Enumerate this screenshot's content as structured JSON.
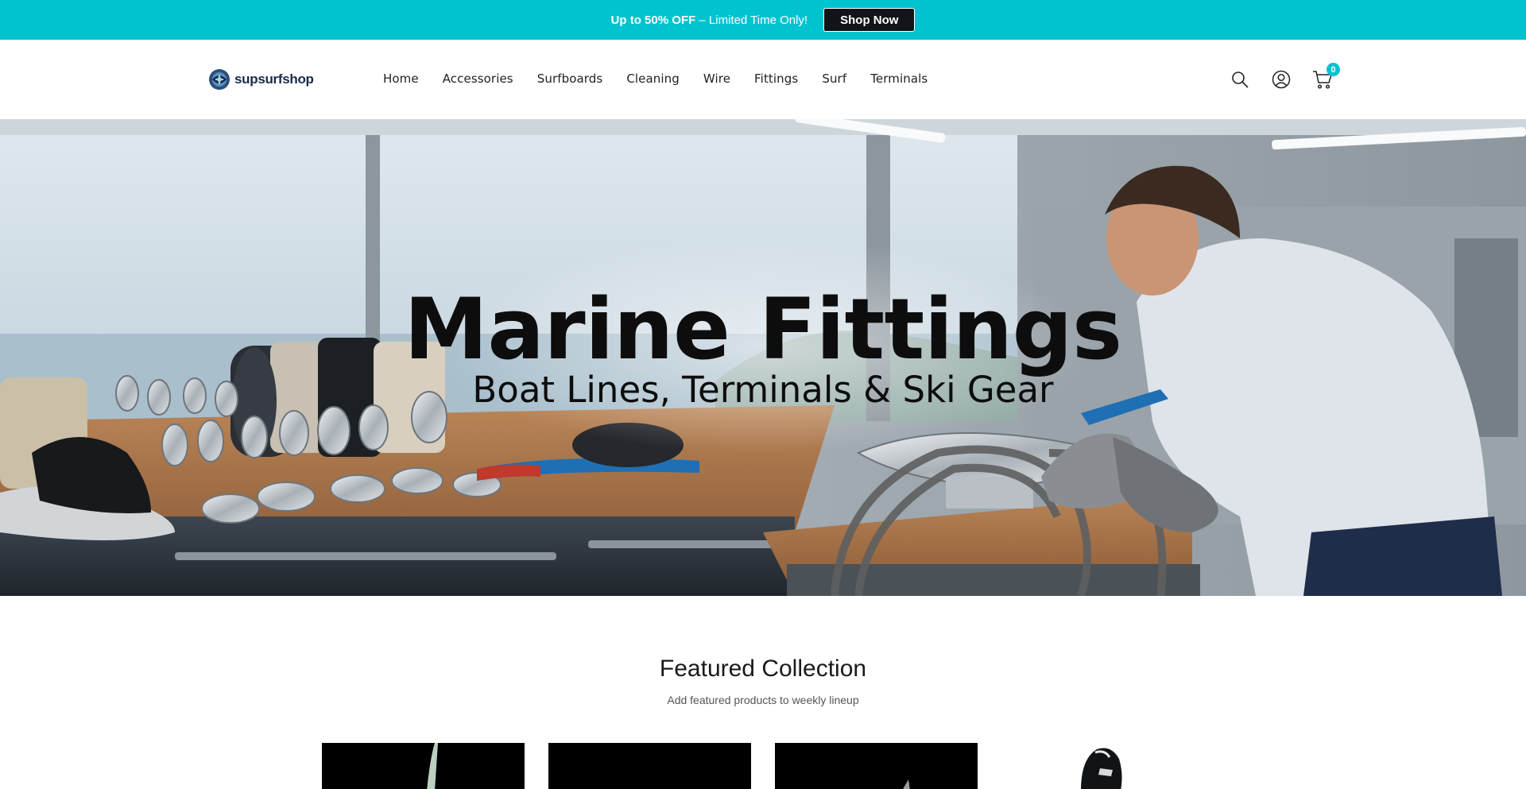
{
  "announcement": {
    "highlight": "Up to 50% OFF",
    "text": " – Limited Time Only!",
    "cta_label": "Shop Now"
  },
  "header": {
    "logo_text": "supsurfshop",
    "nav": [
      {
        "label": "Home"
      },
      {
        "label": "Accessories"
      },
      {
        "label": "Surfboards"
      },
      {
        "label": "Cleaning"
      },
      {
        "label": "Wire"
      },
      {
        "label": "Fittings"
      },
      {
        "label": "Surf"
      },
      {
        "label": "Terminals"
      }
    ],
    "icons": [
      "search-icon",
      "account-icon",
      "cart-icon"
    ],
    "cart_count": "0"
  },
  "hero": {
    "title": "Marine Fittings",
    "subtitle": "Boat Lines, Terminals & Ski Gear"
  },
  "featured": {
    "title": "Featured Collection",
    "subtitle": "Add featured products to weekly lineup",
    "products": [
      {},
      {},
      {},
      {}
    ]
  },
  "colors": {
    "accent": "#00c3cf",
    "button_dark": "#111418",
    "logo_navy": "#1a2b4a"
  }
}
